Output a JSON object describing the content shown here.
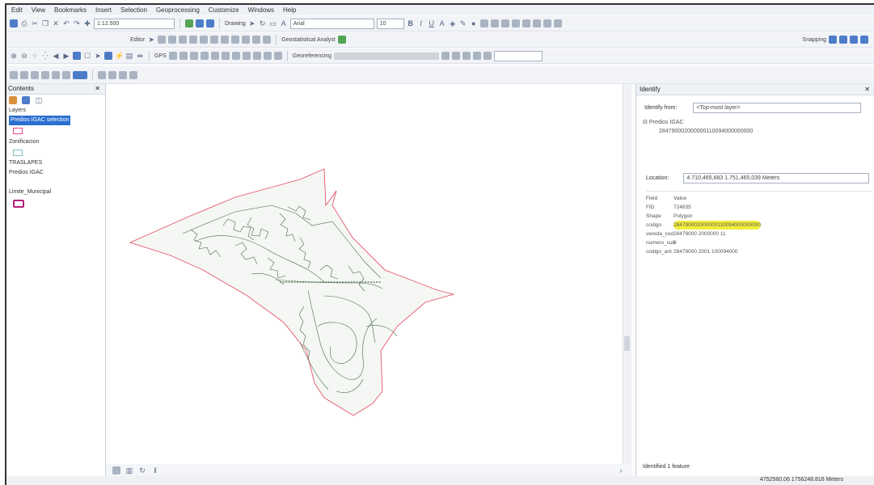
{
  "menu": [
    "Edit",
    "View",
    "Bookmarks",
    "Insert",
    "Selection",
    "Geoprocessing",
    "Customize",
    "Windows",
    "Help"
  ],
  "toolbar": {
    "scale": "1:12.500",
    "drawing_label": "Drawing",
    "font_name": "Arial",
    "font_size": "10",
    "editor_label": "Editor",
    "geostat_label": "Geostatistical Analyst",
    "snapping_label": "Snapping",
    "gps_label": "GPS",
    "georef_label": "Georeferencing"
  },
  "toc": {
    "title": "Contents",
    "group_label": "Layers",
    "layers": [
      {
        "name": "Predios IGAC selection",
        "selected": true,
        "color": "#e64a8a"
      },
      {
        "name": "Zonificacion",
        "selected": false,
        "color": "#7fbfbf"
      },
      {
        "name": "TRASLAPES",
        "selected": false,
        "color": ""
      },
      {
        "name": "Predios IGAC",
        "selected": false,
        "color": ""
      },
      {
        "name": "Limite_Municipal",
        "selected": false,
        "color": "#b0207a"
      }
    ]
  },
  "identify": {
    "title": "Identify",
    "from_label": "Identify from:",
    "from_value": "<Top-most layer>",
    "tree_layer": "Predios IGAC",
    "tree_feature": "284790002000000110094000000000",
    "location_label": "Location:",
    "location_value": "4.710,465,683 1.751,465,039 Meters",
    "fields": [
      {
        "field": "Field",
        "value": "Value"
      },
      {
        "field": "FID",
        "value": "724835"
      },
      {
        "field": "Shape",
        "value": "Polygon"
      },
      {
        "field": "codigo",
        "value": "284790002000000110094000000000",
        "highlight": true
      },
      {
        "field": "vereda_cod",
        "value": "28479000 2000000 11"
      },
      {
        "field": "numero_sub",
        "value": "0"
      },
      {
        "field": "codigo_ant",
        "value": "28479000 2001 100094000"
      }
    ],
    "identified": "Identified 1 feature"
  },
  "status": {
    "coords": "4752560.06 1756248.816 Meters"
  },
  "colors": {
    "boundary": "#e8546b",
    "contours": "#3a5a3a",
    "fill": "#f3f5f3"
  }
}
